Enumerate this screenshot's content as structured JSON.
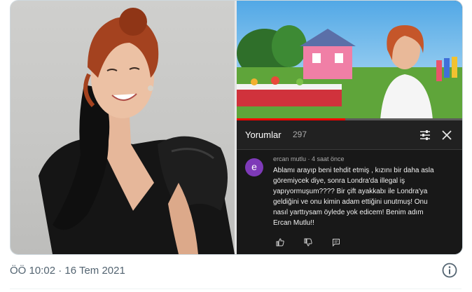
{
  "youtube": {
    "comments_title": "Yorumlar",
    "comments_count": "297",
    "progress_fraction": 0.48,
    "comment": {
      "avatar_letter": "e",
      "author": "ercan mutlu",
      "time_ago": "4 saat önce",
      "meta_separator": " · ",
      "lines": [
        "Ablamı arayıp beni tehdit etmiş , kızını bir daha asla",
        "göremiycek diye, sonra Londra'da illegal iş",
        "yapıyormuşum???? Bir çift ayakkabı ile Londra'ya",
        "geldiğini ve onu kimin adam ettiğini unutmuş! Onu",
        "nasıl yarttıysam öylede yok edicem! Benim adım",
        "Ercan Mutlu!!"
      ]
    }
  },
  "tweet": {
    "timestamp": "ÖÖ 10:02 · 16 Tem 2021"
  },
  "colors": {
    "youtube_red": "#ff0000",
    "avatar_purple": "#7e3ab8",
    "twitter_secondary": "#536471"
  }
}
